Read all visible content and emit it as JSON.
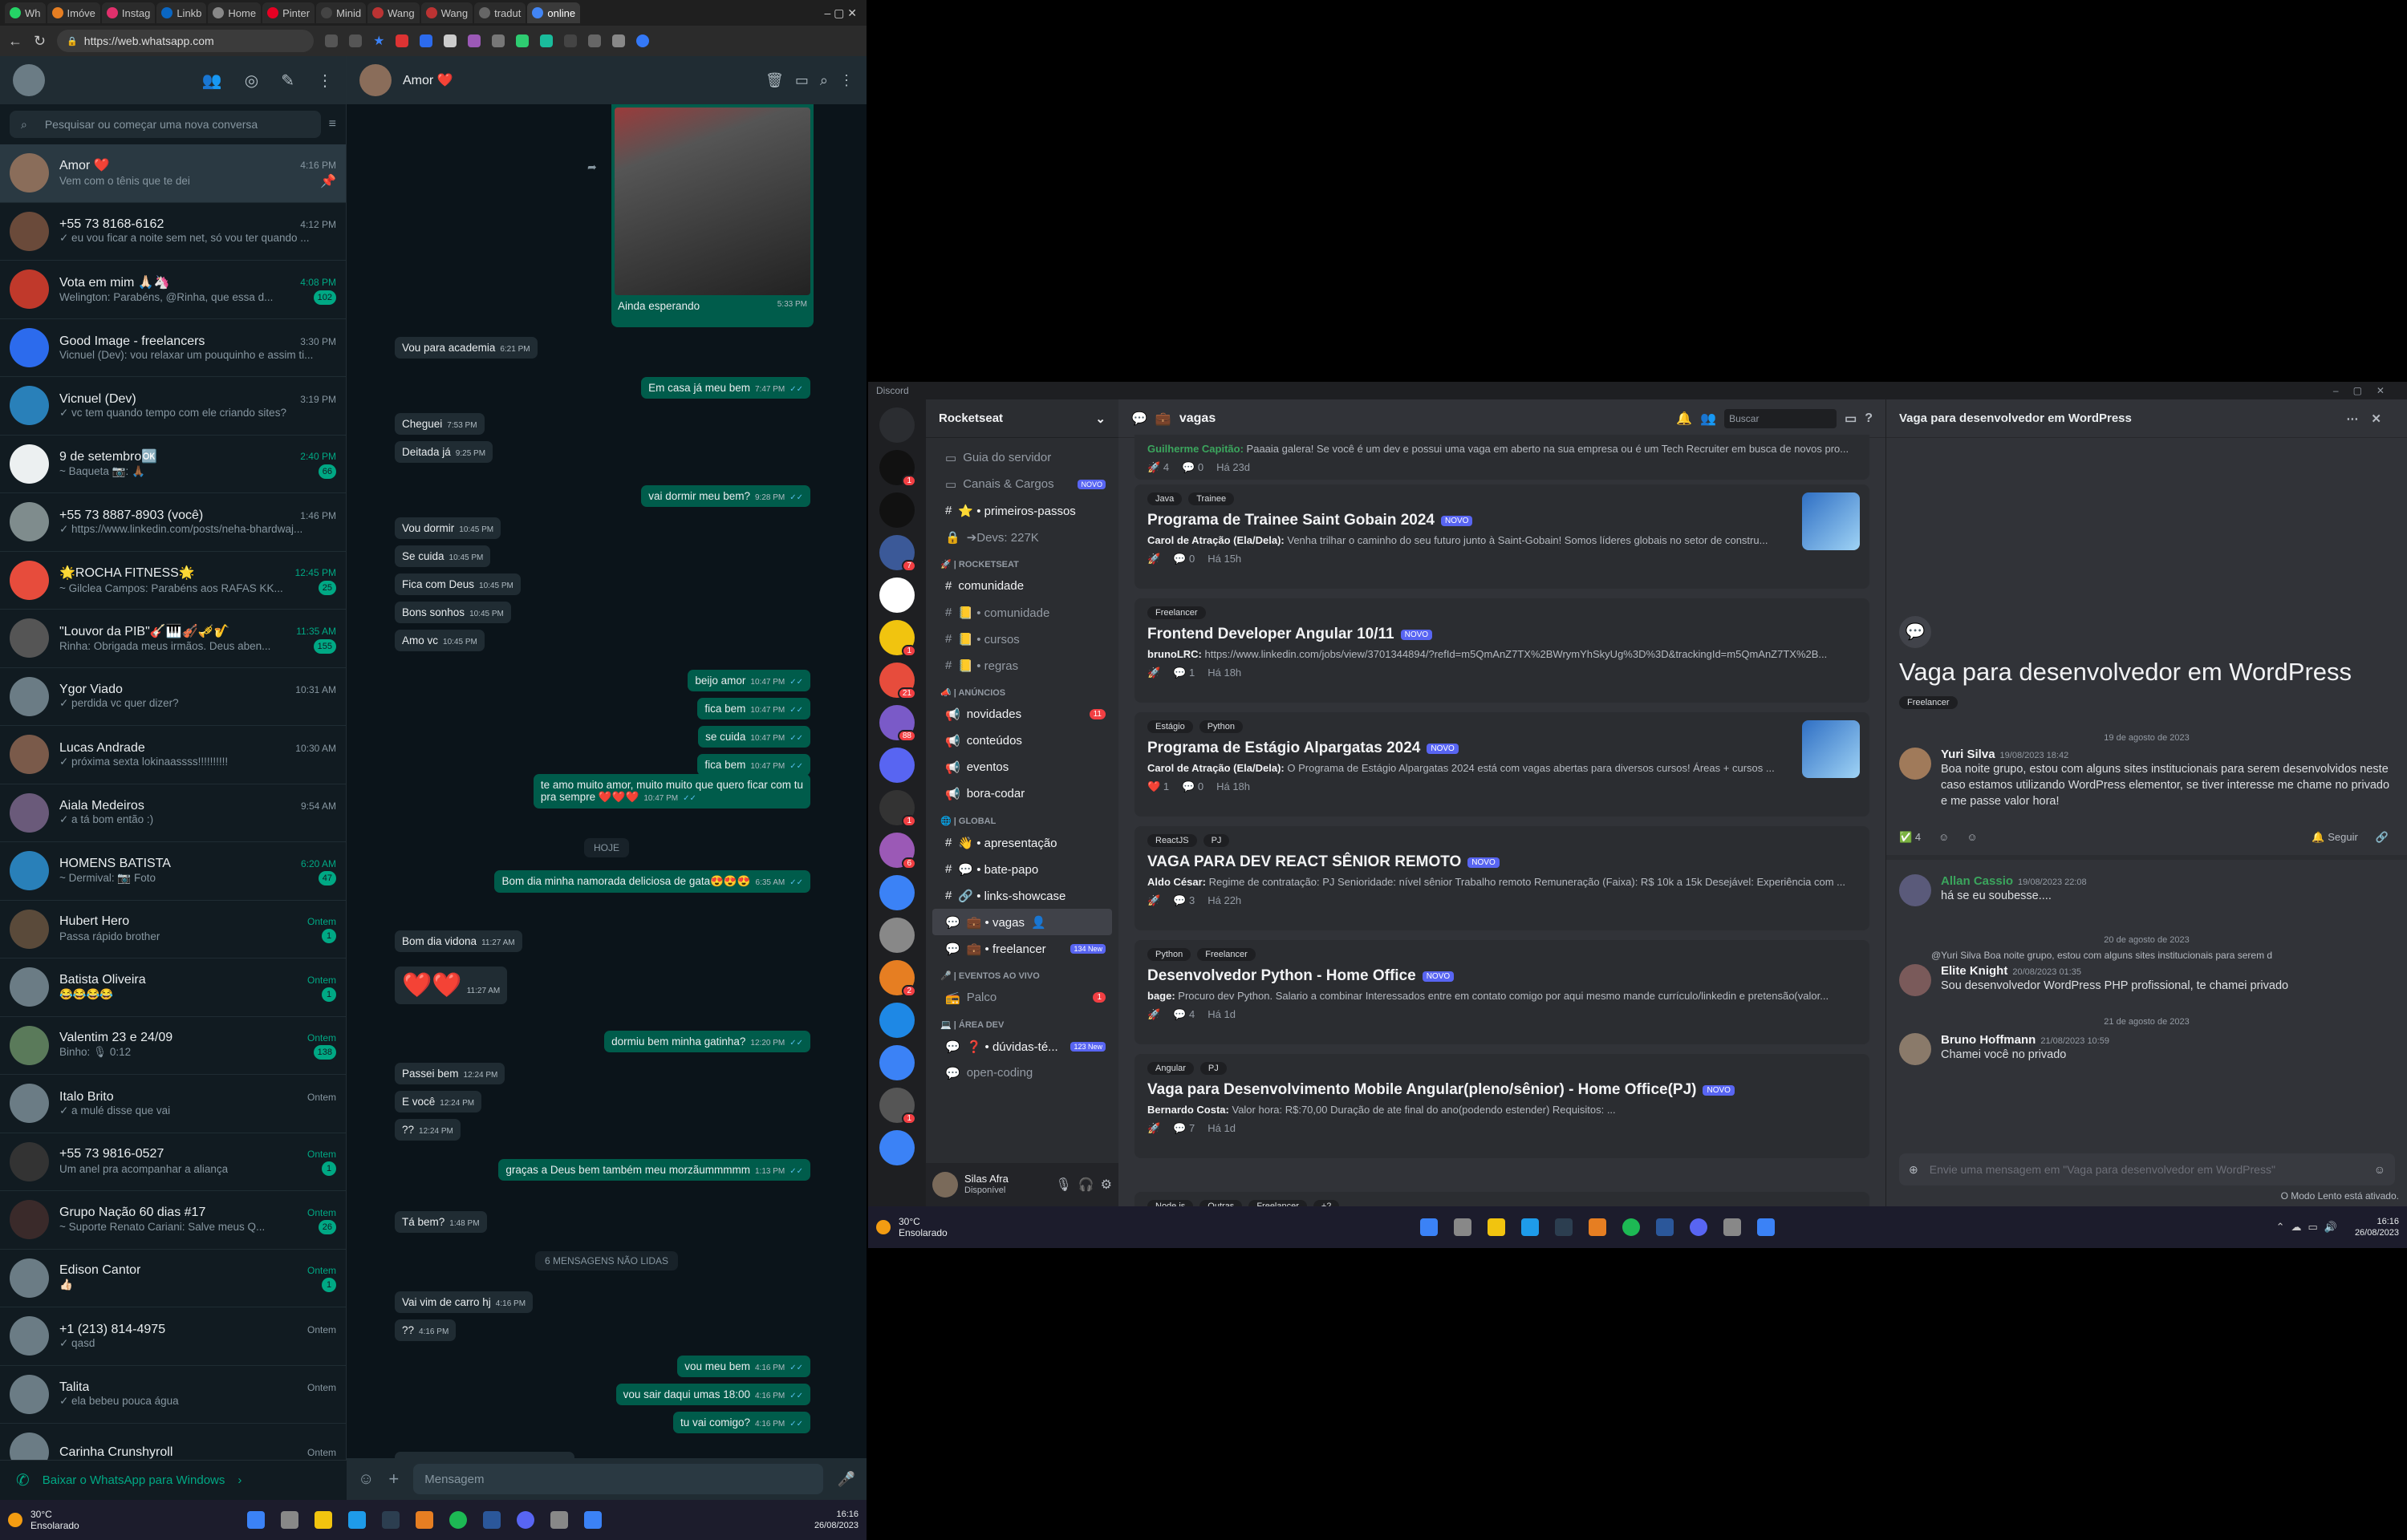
{
  "browser": {
    "tabs": [
      "Wh",
      "Imóve",
      "Instag",
      "Linkb",
      "Home",
      "Pinter",
      "Minid",
      "Wang",
      "Wang",
      "tradut",
      "online"
    ],
    "url": "https://web.whatsapp.com"
  },
  "whatsapp": {
    "search_placeholder": "Pesquisar ou começar uma nova conversa",
    "chats": [
      {
        "name": "Amor ❤️",
        "time": "4:16 PM",
        "preview": "Vem com o tênis que te dei",
        "badge": "",
        "selected": true
      },
      {
        "name": "+55 73 8168-6162",
        "time": "4:12 PM",
        "preview": "✓ eu vou ficar a noite sem net, só vou ter quando ...",
        "badge": ""
      },
      {
        "name": "Vota em mim 🙏🏻🦄",
        "time": "4:08 PM",
        "preview": "Welington: Parabéns, @Rinha, que essa d...",
        "badge": "102"
      },
      {
        "name": "Good Image - freelancers",
        "time": "3:30 PM",
        "preview": "Vicnuel (Dev): vou relaxar um pouquinho e assim ti...",
        "badge": ""
      },
      {
        "name": "Vicnuel (Dev)",
        "time": "3:19 PM",
        "preview": "✓ vc tem quando tempo com ele criando sites?",
        "badge": ""
      },
      {
        "name": "9 de setembro🆗",
        "time": "2:40 PM",
        "preview": "~ Baqueta 📷: 🙏🏾",
        "badge": "66"
      },
      {
        "name": "+55 73 8887-8903 (você)",
        "time": "1:46 PM",
        "preview": "✓ https://www.linkedin.com/posts/neha-bhardwaj...",
        "badge": ""
      },
      {
        "name": "🌟ROCHA FITNESS🌟",
        "time": "12:45 PM",
        "preview": "~ Gilclea Campos: Parabéns aos RAFAS KK...",
        "badge": "25"
      },
      {
        "name": "\"Louvor da PIB\"🎸🎹🎻🎺🎷",
        "time": "11:35 AM",
        "preview": "Rinha: Obrigada meus irmãos. Deus aben...",
        "badge": "155"
      },
      {
        "name": "Ygor Viado",
        "time": "10:31 AM",
        "preview": "✓ perdida vc quer dizer?",
        "badge": ""
      },
      {
        "name": "Lucas Andrade",
        "time": "10:30 AM",
        "preview": "✓ próxima sexta lokinaassss!!!!!!!!!!",
        "badge": ""
      },
      {
        "name": "Aiala Medeiros",
        "time": "9:54 AM",
        "preview": "✓ a tá bom então :)",
        "badge": ""
      },
      {
        "name": "HOMENS BATISTA",
        "time": "6:20 AM",
        "preview": "~ Dermival: 📷 Foto",
        "badge": "47"
      },
      {
        "name": "Hubert Hero",
        "time": "Ontem",
        "preview": "Passa rápido brother",
        "badge": "1"
      },
      {
        "name": "Batista Oliveira",
        "time": "Ontem",
        "preview": "😂😂😂😂",
        "badge": "1"
      },
      {
        "name": "Valentim 23 e 24/09",
        "time": "Ontem",
        "preview": "Binho: 🎙 0:12",
        "badge": "138"
      },
      {
        "name": "Italo Brito",
        "time": "Ontem",
        "preview": "✓ a mulé disse que vai",
        "badge": ""
      },
      {
        "name": "+55 73 9816-0527",
        "time": "Ontem",
        "preview": "Um anel pra acompanhar a aliança",
        "badge": "1"
      },
      {
        "name": "Grupo Nação 60 dias #17",
        "time": "Ontem",
        "preview": "~ Suporte Renato Cariani: Salve meus Q...",
        "badge": "26"
      },
      {
        "name": "Edison Cantor",
        "time": "Ontem",
        "preview": "👍🏻",
        "badge": "1"
      },
      {
        "name": "+1 (213) 814-4975",
        "time": "Ontem",
        "preview": "✓ qasd",
        "badge": ""
      },
      {
        "name": "Talita",
        "time": "Ontem",
        "preview": "✓ ela bebeu pouca água",
        "badge": ""
      },
      {
        "name": "Carinha Crunshyroll",
        "time": "Ontem",
        "preview": "",
        "badge": ""
      }
    ],
    "download_label": "Baixar o WhatsApp para Windows",
    "chat_title": "Amor ❤️",
    "compose_placeholder": "Mensagem",
    "image_caption": "Ainda esperando",
    "image_time": "5:33 PM",
    "messages": [
      {
        "dir": "in",
        "text": "Vou para academia",
        "time": "6:21 PM"
      },
      {
        "dir": "out",
        "text": "Em casa já meu bem",
        "time": "7:47 PM"
      },
      {
        "dir": "in",
        "text": "Cheguei",
        "time": "7:53 PM"
      },
      {
        "dir": "in",
        "text": "Deitada já",
        "time": "9:25 PM"
      },
      {
        "dir": "out",
        "text": "vai dormir meu bem?",
        "time": "9:28 PM"
      },
      {
        "dir": "in",
        "text": "Vou dormir",
        "time": "10:45 PM"
      },
      {
        "dir": "in",
        "text": "Se cuida",
        "time": "10:45 PM"
      },
      {
        "dir": "in",
        "text": "Fica com Deus",
        "time": "10:45 PM"
      },
      {
        "dir": "in",
        "text": "Bons sonhos",
        "time": "10:45 PM"
      },
      {
        "dir": "in",
        "text": "Amo vc",
        "time": "10:45 PM"
      },
      {
        "dir": "out",
        "text": "beijo amor",
        "time": "10:47 PM"
      },
      {
        "dir": "out",
        "text": "fica bem",
        "time": "10:47 PM"
      },
      {
        "dir": "out",
        "text": "se cuida",
        "time": "10:47 PM"
      },
      {
        "dir": "out",
        "text": "fica bem",
        "time": "10:47 PM"
      },
      {
        "dir": "out",
        "text": "te amo muito amor, muito muito que quero ficar com tu",
        "text2": "pra sempre ❤️❤️❤️",
        "time": "10:47 PM"
      },
      {
        "dir": "sep",
        "text": "HOJE"
      },
      {
        "dir": "out",
        "text": "Bom dia minha namorada deliciosa de gata😍😍😍",
        "time": "6:35 AM"
      },
      {
        "dir": "in",
        "text": "Bom dia vidona",
        "time": "11:27 AM"
      },
      {
        "dir": "in",
        "text": "❤️❤️",
        "time": "11:27 AM"
      },
      {
        "dir": "out",
        "text": "dormiu bem minha gatinha?",
        "time": "12:20 PM"
      },
      {
        "dir": "in",
        "text": "Passei bem",
        "time": "12:24 PM"
      },
      {
        "dir": "in",
        "text": "E você",
        "time": "12:24 PM"
      },
      {
        "dir": "in",
        "text": "??",
        "time": "12:24 PM"
      },
      {
        "dir": "out",
        "text": "graças a Deus bem também meu morzãummmmm",
        "time": "1:13 PM"
      },
      {
        "dir": "in",
        "text": "Tá bem?",
        "time": "1:48 PM"
      },
      {
        "dir": "sep",
        "text": "6 MENSAGENS NÃO LIDAS"
      },
      {
        "dir": "in",
        "text": "Vai vim de carro hj",
        "time": "4:16 PM"
      },
      {
        "dir": "in",
        "text": "??",
        "time": "4:16 PM"
      },
      {
        "dir": "out",
        "text": "vou meu bem",
        "time": "4:16 PM"
      },
      {
        "dir": "out",
        "text": "vou sair daqui  umas 18:00",
        "time": "4:16 PM"
      },
      {
        "dir": "out",
        "text": "tu vai comigo?",
        "time": "4:16 PM"
      },
      {
        "dir": "in",
        "text": "Vem com o tênis que te dei",
        "time": "4:16 PM"
      }
    ]
  },
  "taskbar_left": {
    "temp": "30°C",
    "weather": "Ensolarado",
    "time": "16:16",
    "date": "26/08/2023"
  },
  "discord": {
    "app_title": "Discord",
    "server": "Rocketseat",
    "channels": [
      {
        "kind": "link",
        "label": "Guia do servidor"
      },
      {
        "kind": "link",
        "label": "Canais & Cargos",
        "tag": "NOVO"
      },
      {
        "kind": "text",
        "label": "⭐ • primeiros-passos",
        "bright": true
      },
      {
        "kind": "lock",
        "label": "➔Devs: 227K"
      },
      {
        "kind": "cat",
        "label": "🚀 | ROCKETSEAT"
      },
      {
        "kind": "text",
        "label": "comunidade",
        "bright": true
      },
      {
        "kind": "text",
        "label": "📒 • comunidade"
      },
      {
        "kind": "text",
        "label": "📒 • cursos"
      },
      {
        "kind": "text",
        "label": "📒 • regras"
      },
      {
        "kind": "cat",
        "label": "📣 | ANÚNCIOS"
      },
      {
        "kind": "announce",
        "label": "novidades",
        "badge": "11",
        "bright": true
      },
      {
        "kind": "announce",
        "label": "conteúdos",
        "bright": true
      },
      {
        "kind": "announce",
        "label": "eventos",
        "bright": true
      },
      {
        "kind": "announce",
        "label": "bora-codar",
        "bright": true
      },
      {
        "kind": "cat",
        "label": "🌐 | GLOBAL"
      },
      {
        "kind": "text",
        "label": "👋 • apresentação",
        "bright": true
      },
      {
        "kind": "text",
        "label": "💬 • bate-papo",
        "bright": true
      },
      {
        "kind": "text",
        "label": "🔗 • links-showcase",
        "bright": true
      },
      {
        "kind": "forum",
        "label": "💼 • vagas",
        "selected": true
      },
      {
        "kind": "forum",
        "label": "💼 • freelancer",
        "tag": "134 New",
        "bright": true
      },
      {
        "kind": "cat",
        "label": "🎤 | EVENTOS AO VIVO"
      },
      {
        "kind": "stage",
        "label": "Palco",
        "badge": "1"
      },
      {
        "kind": "cat",
        "label": "💻 | ÁREA DEV"
      },
      {
        "kind": "forum",
        "label": "❓ • dúvidas-té...",
        "tag": "123 New",
        "bright": true
      },
      {
        "kind": "forum",
        "label": "open-coding"
      }
    ],
    "user": {
      "name": "Silas Afra",
      "status": "Disponível"
    },
    "channel_title": "vagas",
    "search_placeholder": "Buscar",
    "top_partial": {
      "author": "Guilherme Capitão:",
      "text": "Paaaia galera! Se você é um dev e possui uma vaga em aberto na sua empresa ou é um Tech Recruiter em busca de novos pro...",
      "likes": "4",
      "comments": "0",
      "age": "Há 23d"
    },
    "posts": [
      {
        "tags": [
          "Java",
          "Trainee"
        ],
        "title": "Programa de Trainee Saint Gobain 2024",
        "isnew": "NOVO",
        "author": "Carol de Atração (Ela/Dela):",
        "text": "Venha trilhar o caminho do seu futuro junto à Saint-Gobain! Somos líderes globais no setor de constru...",
        "likes": "",
        "comments": "0",
        "age": "Há 15h",
        "thumb": true
      },
      {
        "tags": [
          "Freelancer"
        ],
        "title": "Frontend Developer Angular 10/11",
        "isnew": "NOVO",
        "author": "brunoLRC:",
        "text": "https://www.linkedin.com/jobs/view/3701344894/?refId=m5QmAnZ7TX%2BWrymYhSkyUg%3D%3D&trackingId=m5QmAnZ7TX%2B...",
        "likes": "",
        "comments": "1",
        "age": "Há 18h"
      },
      {
        "tags": [
          "Estágio",
          "Python"
        ],
        "title": "Programa de Estágio Alpargatas 2024",
        "isnew": "NOVO",
        "author": "Carol de Atração (Ela/Dela):",
        "text": "O Programa de Estágio Alpargatas 2024 está com vagas abertas para diversos cursos! Áreas + cursos ...",
        "likes": "1",
        "comments": "0",
        "age": "Há 18h",
        "thumb": true
      },
      {
        "tags": [
          "ReactJS",
          "PJ"
        ],
        "title": "VAGA PARA DEV REACT SÊNIOR REMOTO",
        "isnew": "NOVO",
        "author": "Aldo César:",
        "text": "Regime de contratação: PJ Senioridade: nível sênior Trabalho remoto Remuneração (Faixa): R$ 10k a 15k Desejável: Experiência com ...",
        "likes": "",
        "comments": "3",
        "age": "Há 22h"
      },
      {
        "tags": [
          "Python",
          "Freelancer"
        ],
        "title": "Desenvolvedor Python - Home Office",
        "isnew": "NOVO",
        "author": "bage:",
        "text": "Procuro dev Python. Salario a combinar Interessados entre em contato comigo por aqui mesmo mande currículo/linkedin e pretensão(valor...",
        "likes": "",
        "comments": "4",
        "age": "Há 1d"
      },
      {
        "tags": [
          "Angular",
          "PJ"
        ],
        "title": "Vaga para Desenvolvimento Mobile Angular(pleno/sênior) - Home Office(PJ)",
        "isnew": "NOVO",
        "author": "Bernardo Costa:",
        "text": "Valor hora: R$:70,00 Duração de ate final do ano(podendo estender) Requisitos: ...",
        "likes": "",
        "comments": "7",
        "age": "Há 1d"
      }
    ],
    "last_tags": [
      "Node.js",
      "Outras",
      "Freelancer",
      "+2"
    ],
    "thread": {
      "header": "Vaga para desenvolvedor em WordPress",
      "title": "Vaga para desenvolvedor em WordPress",
      "tag": "Freelancer",
      "date1": "19 de agosto de 2023",
      "op": {
        "name": "Yuri Silva",
        "stamp": "19/08/2023 18:42",
        "text": "Boa noite grupo, estou com alguns sites institucionais para serem desenvolvidos neste caso estamos utilizando WordPress elementor, se tiver interesse me chame no privado e me passe valor hora!"
      },
      "reactions": "4",
      "follow": "Seguir",
      "reply1": {
        "name": "Allan Cassio",
        "stamp": "19/08/2023 22:08",
        "text": "há se eu soubesse...."
      },
      "date2": "20 de agosto de 2023",
      "reply2_ref": "@Yuri Silva Boa noite grupo, estou com alguns sites institucionais para serem d",
      "reply2": {
        "name": "Elite Knight",
        "stamp": "20/08/2023 01:35",
        "text": "Sou desenvolvedor WordPress PHP profissional, te chamei privado"
      },
      "date3": "21 de agosto de 2023",
      "reply3": {
        "name": "Bruno Hoffmann",
        "stamp": "21/08/2023 10:59",
        "text": "Chamei você no privado"
      },
      "compose": "Envie uma mensagem em \"Vaga para desenvolvedor em WordPress\"",
      "slowmode": "O Modo Lento está ativado."
    },
    "taskbar": {
      "temp": "30°C",
      "weather": "Ensolarado",
      "time": "16:16",
      "date": "26/08/2023"
    }
  }
}
